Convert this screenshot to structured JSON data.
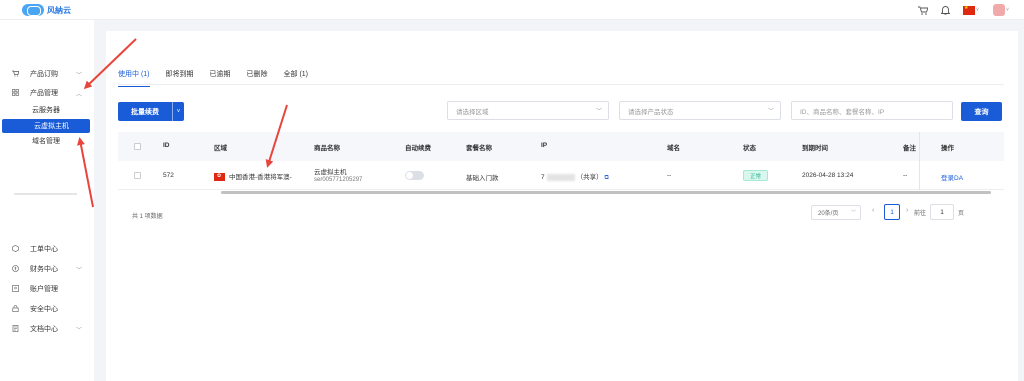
{
  "brand": {
    "name": "风納云"
  },
  "topbar": {
    "cart_icon": "cart-icon",
    "bell_icon": "bell-icon",
    "flag": "china-flag",
    "lang_caret": "˅",
    "user_caret": "˅"
  },
  "sidebar": {
    "groups": [
      {
        "label": "产品订购",
        "icon": "cart-icon",
        "chevron": "﹀"
      },
      {
        "label": "产品管理",
        "icon": "grid-icon",
        "chevron": "︿"
      }
    ],
    "sub_items": [
      "云服务器",
      "云虚拟主机",
      "域名管理"
    ],
    "bottom": [
      {
        "label": "工单中心",
        "icon": "ticket-icon"
      },
      {
        "label": "财务中心",
        "icon": "finance-icon",
        "chevron": "﹀"
      },
      {
        "label": "账户管理",
        "icon": "account-icon"
      },
      {
        "label": "安全中心",
        "icon": "lock-icon"
      },
      {
        "label": "文档中心",
        "icon": "doc-icon",
        "chevron": "﹀"
      }
    ]
  },
  "tabs": [
    "使用中 (1)",
    "即将到期",
    "已逾期",
    "已删除",
    "全部 (1)"
  ],
  "toolbar": {
    "batch_renew": "批量续费",
    "area_placeholder": "请选择区域",
    "status_placeholder": "请选择产品状态",
    "search_placeholder": "ID、商品名称、套餐名称、IP",
    "query": "查询"
  },
  "table": {
    "headers": [
      "ID",
      "区域",
      "商品名称",
      "自动续费",
      "套餐名称",
      "IP",
      "域名",
      "状态",
      "到期时间",
      "备注",
      "操作"
    ],
    "rows": [
      {
        "id": "572",
        "region": "中国香港-香港将军澳-",
        "product_name": "云虚拟主机",
        "product_code": "ser005771205297",
        "plan": "基础入门款",
        "ip_prefix": "7",
        "ip_suffix": "（共享）",
        "domain": "--",
        "status": "正常",
        "expire": "2026-04-28 13:24",
        "note": "--",
        "action": "登录DA"
      }
    ]
  },
  "pagination": {
    "total": "共 1 项数据",
    "page_size": "20条/页",
    "current": "1",
    "goto_label": "前往",
    "goto_value": "1",
    "page_suffix": "页"
  },
  "colors": {
    "primary": "#1a5cd8",
    "annotation": "#e8453c",
    "success": "#27b38a"
  }
}
